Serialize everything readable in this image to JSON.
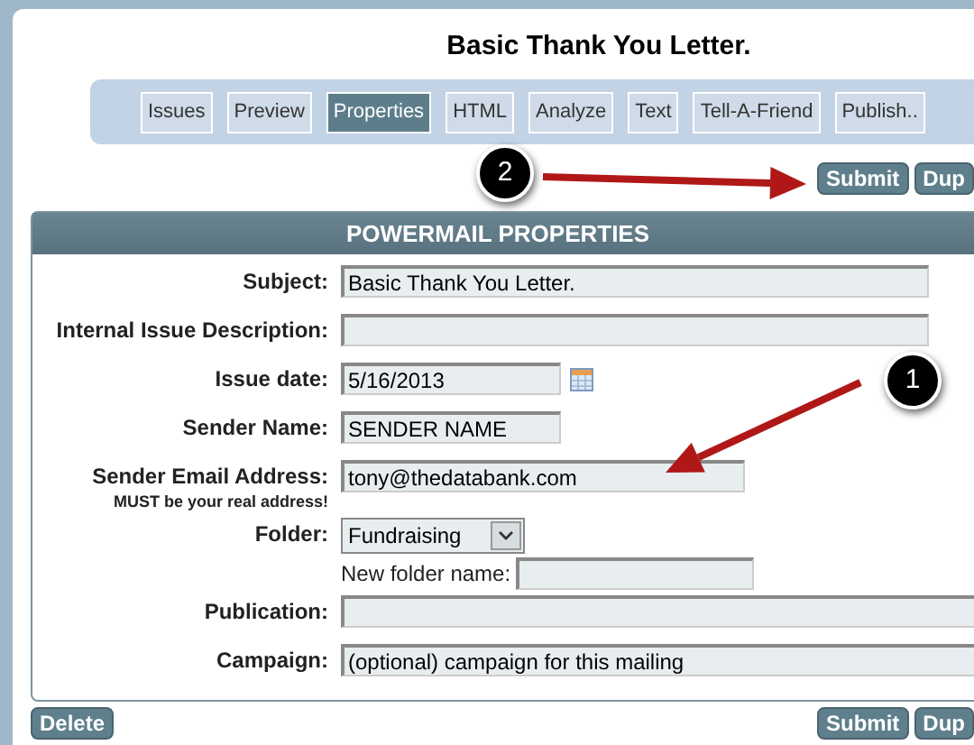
{
  "title": "Basic Thank You Letter.",
  "tabs": [
    {
      "label": "Issues",
      "selected": false
    },
    {
      "label": "Preview",
      "selected": false
    },
    {
      "label": "Properties",
      "selected": true
    },
    {
      "label": "HTML",
      "selected": false
    },
    {
      "label": "Analyze",
      "selected": false
    },
    {
      "label": "Text",
      "selected": false
    },
    {
      "label": "Tell-A-Friend",
      "selected": false
    },
    {
      "label": "Publish..",
      "selected": false
    }
  ],
  "top_buttons": [
    "Submit",
    "Dup"
  ],
  "panel": {
    "title": "POWERMAIL PROPERTIES",
    "fields": [
      {
        "kind": "text",
        "label": "Subject:",
        "value": "Basic Thank You Letter."
      },
      {
        "kind": "text",
        "label": "Internal Issue Description:"
      },
      {
        "kind": "date",
        "label": "Issue date:",
        "value": "5/16/2013"
      },
      {
        "kind": "text",
        "label": "Sender Name:",
        "value": "SENDER NAME"
      },
      {
        "kind": "text",
        "label": "Sender Email Address:",
        "note": "MUST be your real address!",
        "value": "tony@thedatabank.com"
      },
      {
        "kind": "select",
        "label": "Folder:",
        "value": "Fundraising",
        "sub_label": "New folder name:"
      },
      {
        "kind": "text",
        "label": "Publication:"
      },
      {
        "kind": "text",
        "label": "Campaign:",
        "value": "(optional) campaign for this mailing"
      }
    ]
  },
  "callouts": [
    "2",
    "1"
  ],
  "bottom_buttons": {
    "left": "Delete",
    "right": [
      "Submit",
      "Dup"
    ]
  }
}
